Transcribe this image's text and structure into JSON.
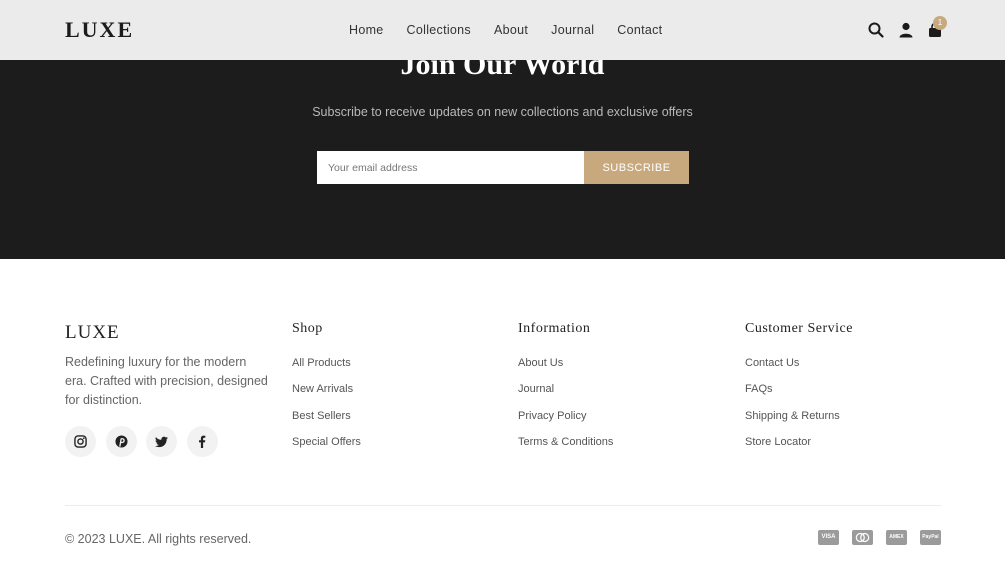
{
  "header": {
    "logo": "LUXE",
    "nav": [
      "Home",
      "Collections",
      "About",
      "Journal",
      "Contact"
    ],
    "cart_count": "1",
    "icons": [
      "search-icon",
      "user-icon",
      "bag-icon"
    ]
  },
  "newsletter": {
    "title": "Join Our World",
    "subtitle": "Subscribe to receive updates on new collections and exclusive offers",
    "placeholder": "Your email address",
    "button": "SUBSCRIBE"
  },
  "footer": {
    "logo": "LUXE",
    "description": "Redefining luxury for the modern era. Crafted with precision, designed for distinction.",
    "socials": [
      "instagram-icon",
      "pinterest-icon",
      "twitter-icon",
      "facebook-icon"
    ],
    "columns": [
      {
        "title": "Shop",
        "links": [
          "All Products",
          "New Arrivals",
          "Best Sellers",
          "Special Offers"
        ]
      },
      {
        "title": "Information",
        "links": [
          "About Us",
          "Journal",
          "Privacy Policy",
          "Terms & Conditions"
        ]
      },
      {
        "title": "Customer Service",
        "links": [
          "Contact Us",
          "FAQs",
          "Shipping & Returns",
          "Store Locator"
        ]
      }
    ],
    "copyright": "© 2023 LUXE. All rights reserved.",
    "payments": [
      "VISA",
      "",
      "AMEX",
      "PayPal"
    ]
  },
  "colors": {
    "accent": "#c8a97e",
    "dark": "#1c1c1c",
    "header_bg": "#ebebeb"
  }
}
